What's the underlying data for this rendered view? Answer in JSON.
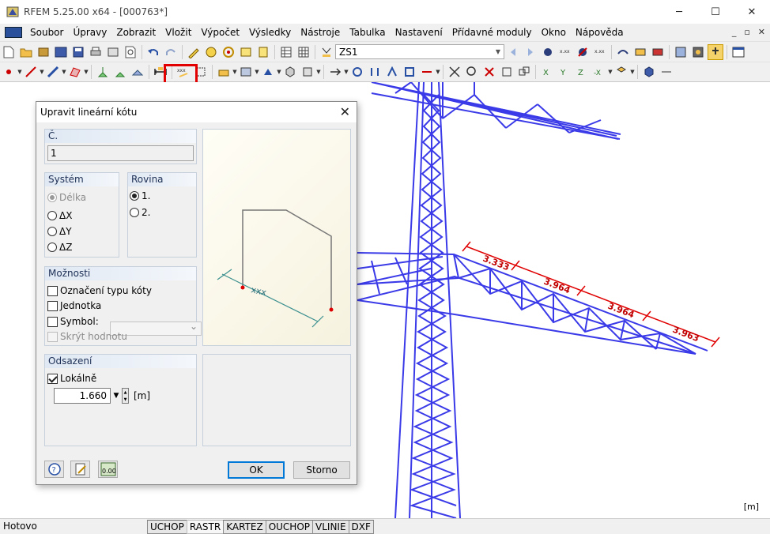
{
  "window": {
    "title": "RFEM 5.25.00 x64 - [000763*]",
    "minimize": "─",
    "maximize": "☐",
    "close": "✕"
  },
  "menu": {
    "items": [
      "Soubor",
      "Úpravy",
      "Zobrazit",
      "Vložit",
      "Výpočet",
      "Výsledky",
      "Nástroje",
      "Tabulka",
      "Nastavení",
      "Přídavné moduly",
      "Okno",
      "Nápověda"
    ],
    "mdi": [
      "_",
      "▫",
      "✕"
    ]
  },
  "toolbar": {
    "load_case": "ZS1",
    "highlighted_tool": "dimension-linear-icon"
  },
  "canvas": {
    "units": "[m]",
    "dimension_color": "#e00000",
    "structure_color": "#3a3ae8",
    "dimensions": [
      "3.333",
      "3.964",
      "3.964",
      "3.963"
    ]
  },
  "dialog": {
    "title": "Upravit lineární kótu",
    "number_label": "Č.",
    "number_value": "1",
    "system_label": "Systém",
    "system_options": [
      "Délka",
      "ΔX",
      "ΔY",
      "ΔZ"
    ],
    "system_selected": "Délka",
    "plane_label": "Rovina",
    "plane_options": [
      "1.",
      "2."
    ],
    "plane_selected": "1.",
    "options_label": "Možnosti",
    "opt_type_label": "Označení typu kóty",
    "opt_unit_label": "Jednotka",
    "opt_symbol_label": "Symbol:",
    "opt_hide_label": "Skrýt hodnotu",
    "offset_label": "Odsazení",
    "offset_local_label": "Lokálně",
    "offset_local_checked": true,
    "offset_value": "1.660",
    "offset_unit": "[m]",
    "preview_text": "xxx",
    "ok_label": "OK",
    "cancel_label": "Storno"
  },
  "status": {
    "text": "Hotovo",
    "buttons": [
      "UCHOP",
      "RASTR",
      "KARTEZ",
      "OUCHOP",
      "VLINIE",
      "DXF"
    ],
    "active": "RASTR"
  }
}
